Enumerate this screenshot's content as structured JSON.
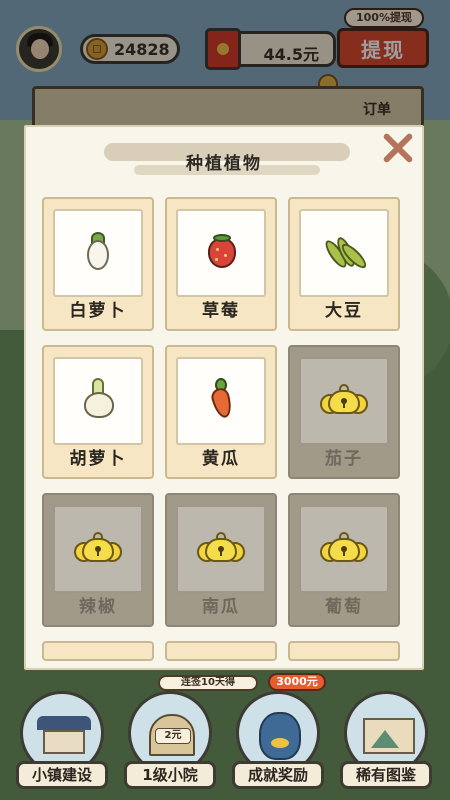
{
  "hud": {
    "coins": "24828",
    "cash": "44.5元",
    "withdraw_label": "提现",
    "withdraw_tag": "100%提现"
  },
  "background": {
    "order_label": "订单"
  },
  "modal": {
    "title": "种植植物",
    "plants": [
      {
        "name": "白萝卜",
        "locked": false,
        "icon": "white-radish-icon"
      },
      {
        "name": "草莓",
        "locked": false,
        "icon": "strawberry-icon"
      },
      {
        "name": "大豆",
        "locked": false,
        "icon": "soybean-icon"
      },
      {
        "name": "胡萝卜",
        "locked": false,
        "icon": "garlic-icon"
      },
      {
        "name": "黄瓜",
        "locked": false,
        "icon": "carrot-icon"
      },
      {
        "name": "茄子",
        "locked": true,
        "icon": "lock-icon"
      },
      {
        "name": "辣椒",
        "locked": true,
        "icon": "lock-icon"
      },
      {
        "name": "南瓜",
        "locked": true,
        "icon": "lock-icon"
      },
      {
        "name": "葡萄",
        "locked": true,
        "icon": "lock-icon"
      }
    ]
  },
  "bottom_nav": {
    "banner": "连签10天得",
    "banner_reward": "3000元",
    "items": [
      {
        "label": "小镇建设"
      },
      {
        "label": "1级小院",
        "badge": "2元"
      },
      {
        "label": "成就奖励"
      },
      {
        "label": "稀有图鉴"
      }
    ]
  }
}
